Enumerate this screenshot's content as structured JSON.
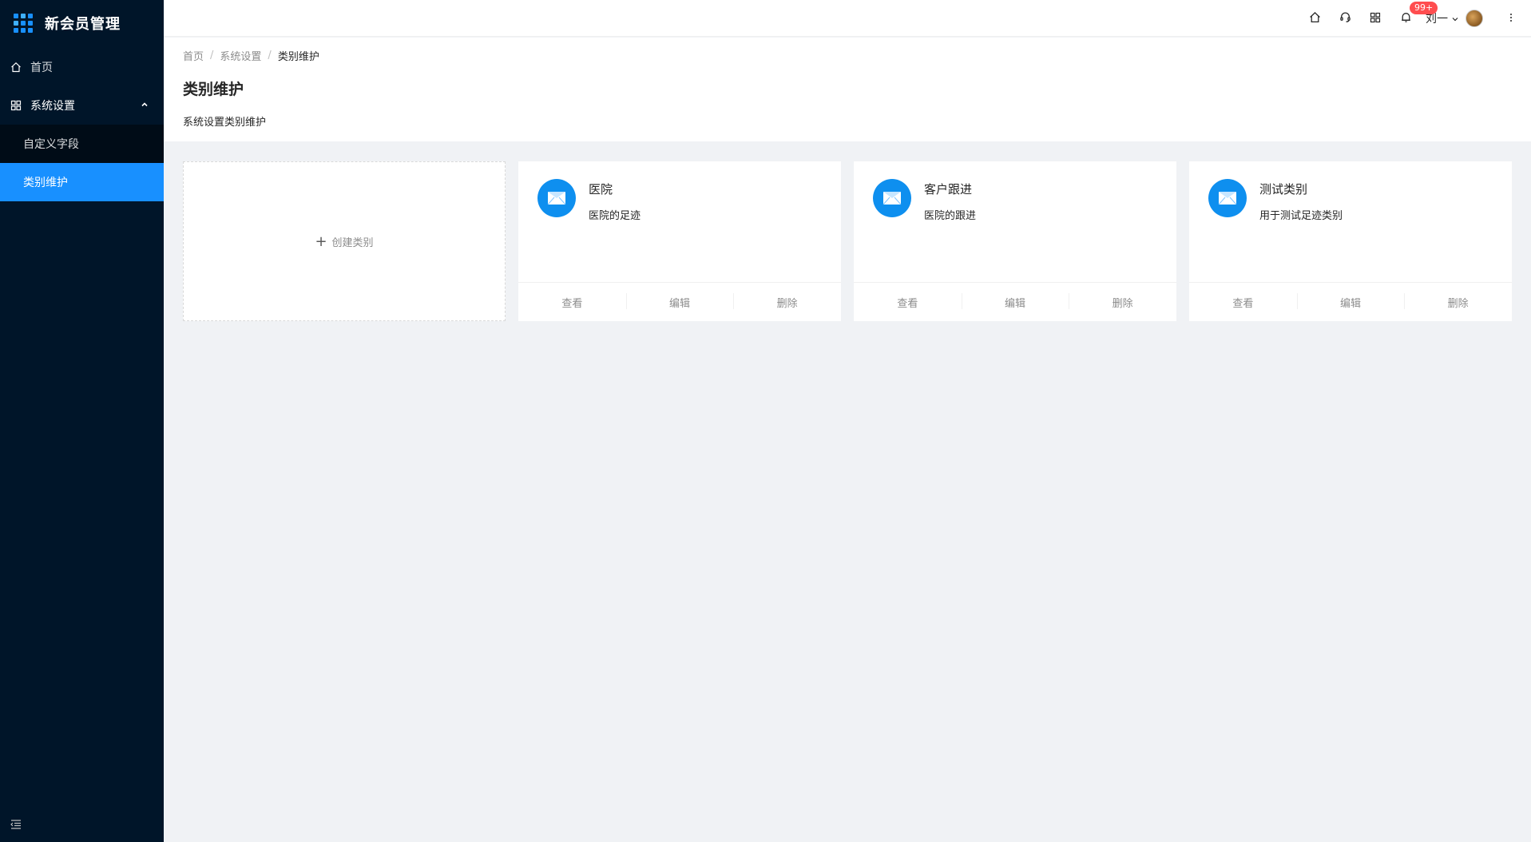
{
  "app": {
    "title": "新会员管理",
    "brand_color": "#1890ff"
  },
  "sidebar": {
    "items": [
      {
        "label": "首页",
        "icon": "home-icon"
      },
      {
        "label": "系统设置",
        "icon": "appstore-icon",
        "expanded": true,
        "children": [
          {
            "label": "自定义字段",
            "active": false
          },
          {
            "label": "类别维护",
            "active": true
          }
        ]
      }
    ],
    "collapse_icon": "menu-fold-icon"
  },
  "header": {
    "icons": [
      "home-icon",
      "customer-service-icon",
      "appstore-icon",
      "bell-icon"
    ],
    "notification_badge": "99+",
    "user_name": "刘一",
    "more_icon": "more-vertical-icon"
  },
  "page": {
    "breadcrumb": [
      "首页",
      "系统设置",
      "类别维护"
    ],
    "title": "类别维护",
    "description": "系统设置类别维护"
  },
  "create_card": {
    "label": "创建类别"
  },
  "cards": [
    {
      "title": "医院",
      "description": "医院的足迹",
      "actions": [
        "查看",
        "编辑",
        "删除"
      ]
    },
    {
      "title": "客户跟进",
      "description": "医院的跟进",
      "actions": [
        "查看",
        "编辑",
        "删除"
      ]
    },
    {
      "title": "测试类别",
      "description": "用于测试足迹类别",
      "actions": [
        "查看",
        "编辑",
        "删除"
      ]
    }
  ]
}
